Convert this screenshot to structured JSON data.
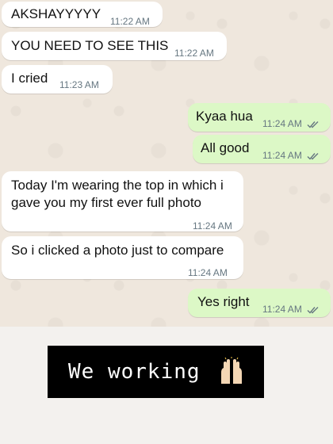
{
  "messages": [
    {
      "text": "AKSHAYYYYY",
      "time": "11:22 AM",
      "dir": "in"
    },
    {
      "text": "YOU NEED TO SEE THIS",
      "time": "11:22 AM",
      "dir": "in"
    },
    {
      "text": "I cried",
      "time": "11:23 AM",
      "dir": "in"
    },
    {
      "text": "Kyaa hua",
      "time": "11:24 AM",
      "dir": "out"
    },
    {
      "text": "All good",
      "time": "11:24 AM",
      "dir": "out"
    },
    {
      "text": "Today I'm wearing the top in which i gave you my first ever full photo",
      "time": "11:24 AM",
      "dir": "in"
    },
    {
      "text": "So i clicked a photo just to compare",
      "time": "11:24 AM",
      "dir": "in"
    },
    {
      "text": "Yes right",
      "time": "11:24 AM",
      "dir": "out"
    }
  ],
  "caption": {
    "text": "We working",
    "emoji_name": "raising-hands-icon"
  },
  "colors": {
    "incoming": "#ffffff",
    "outgoing": "#dcf8c6",
    "tick": "#667781",
    "caption_bg": "#000000"
  }
}
